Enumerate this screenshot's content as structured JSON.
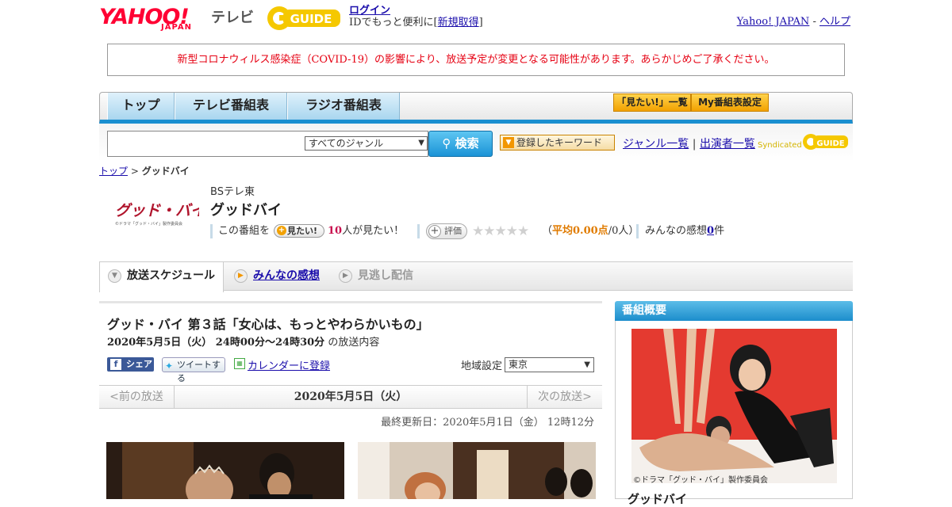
{
  "header": {
    "yahoo_logo": "YAHOO!",
    "japan_logo": "JAPAN",
    "tv_label": "テレビ",
    "gguide_logo": "G GUIDE",
    "login_label": "ログイン",
    "login_hint_prefix": "IDでもっと便利に[",
    "signup_label": "新規取得",
    "login_hint_suffix": "]",
    "yahoo_japan_link": "Yahoo! JAPAN",
    "separator": " - ",
    "help_link": "ヘルプ"
  },
  "notice": {
    "text": "新型コロナウィルス感染症（COVID-19）の影響により、放送予定が変更となる可能性があります。あらかじめご了承ください。",
    "color": "#e60012"
  },
  "nav": {
    "tabs": [
      {
        "label": "トップ"
      },
      {
        "label": "テレビ番組表"
      },
      {
        "label": "ラジオ番組表"
      }
    ],
    "mitai_list": "「見たい!」一覧",
    "my_schedule": "My番組表設定",
    "accent_color": "#1a8fd0"
  },
  "search": {
    "input_value": "",
    "genre_selected": "すべてのジャンル",
    "search_button": "検索",
    "keyword_button": "登録したキーワード",
    "genre_list_link": "ジャンル一覧",
    "link_separator": "|",
    "cast_list_link": "出演者一覧",
    "syndicated_label": "Syndicated",
    "syndicated_logo": "G GUIDE"
  },
  "breadcrumb": {
    "top": "トップ",
    "sep": " > ",
    "current": "グッドバイ"
  },
  "program": {
    "logo_text": "グッド・バイ",
    "logo_caption": "©ドラマ「グッド・バイ」製作委員会",
    "channel": "BSテレ東",
    "title": "グッドバイ",
    "mitai_prefix": "この番組を",
    "mitai_button": "見たい!",
    "mitai_count": "10",
    "mitai_suffix": "人が見たい！",
    "rating_button": "評価",
    "stars": "★★★★★",
    "rating_open": "（",
    "rating_avg": "平均0.00点",
    "rating_count": "/0人）",
    "impressions_prefix": "みんなの感想",
    "impressions_count": "0",
    "impressions_suffix": "件",
    "count_color": "#c8104e",
    "avg_color": "#e07b00"
  },
  "tabs": [
    {
      "label": "放送スケジュール",
      "icon": "chevron-down-icon"
    },
    {
      "label": "みんなの感想",
      "icon": "play-icon"
    },
    {
      "label": "見逃し配信",
      "icon": "play-icon"
    }
  ],
  "episode": {
    "title": "グッド・バイ 第３話「女心は、もっとやわらかいもの」",
    "date_time": "2020年5月5日（火） 24時00分～24時30分",
    "date_suffix": "の放送内容",
    "share_fb": "シェア",
    "tweet": "ツイートする",
    "calendar": "カレンダーに登録",
    "region_label": "地域設定",
    "region_selected": "東京"
  },
  "pager": {
    "prev": "<前の放送",
    "current": "2020年5月5日（火）",
    "next": "次の放送>"
  },
  "updated": "最終更新日：2020年5月1日（金） 12時12分",
  "sidebar": {
    "heading": "番組概要",
    "credit": "©ドラマ「グッド・バイ」製作委員会",
    "title": "グッドバイ"
  }
}
